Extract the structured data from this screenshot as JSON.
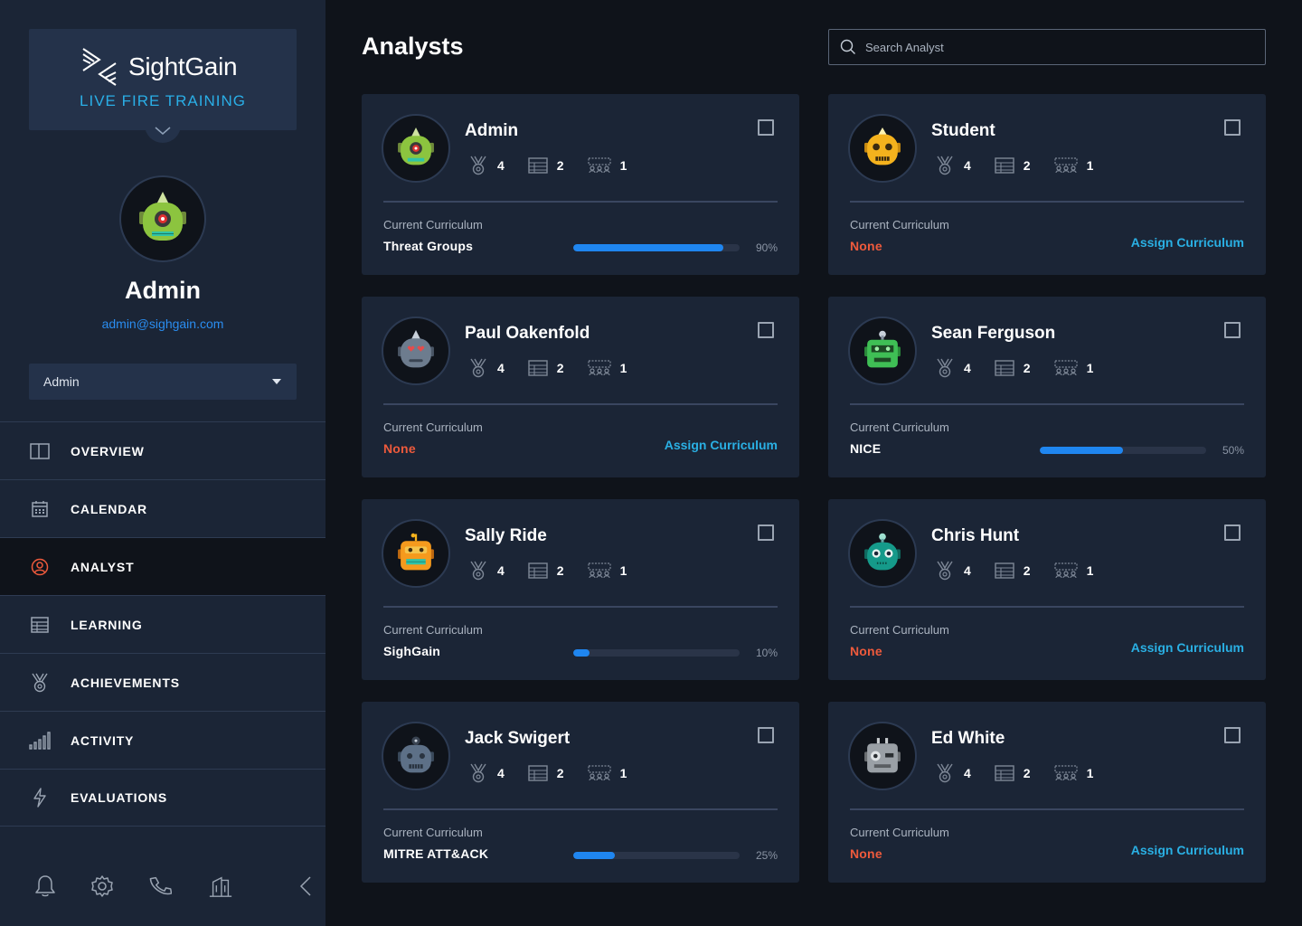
{
  "brand": {
    "name": "SightGain",
    "subtitle": "LIVE FIRE TRAINING"
  },
  "profile": {
    "name": "Admin",
    "email": "admin@sighgain.com",
    "role": "Admin"
  },
  "nav": [
    {
      "label": "OVERVIEW",
      "icon": "columns-icon"
    },
    {
      "label": "CALENDAR",
      "icon": "calendar-icon"
    },
    {
      "label": "ANALYST",
      "icon": "user-circle-icon",
      "active": true
    },
    {
      "label": "LEARNING",
      "icon": "table-icon"
    },
    {
      "label": "ACHIEVEMENTS",
      "icon": "medal-icon"
    },
    {
      "label": "ACTIVITY",
      "icon": "signal-bars-icon"
    },
    {
      "label": "EVALUATIONS",
      "icon": "lightning-icon"
    }
  ],
  "footer_icons": [
    "bell-icon",
    "gear-icon",
    "phone-icon",
    "building-icon",
    "collapse-chevron-icon"
  ],
  "page": {
    "title": "Analysts",
    "search_placeholder": "Search Analyst"
  },
  "labels": {
    "current_curriculum": "Current Curriculum",
    "assign": "Assign Curriculum"
  },
  "colors": {
    "accent_blue": "#1f86f0",
    "assign_cyan": "#2ab0e4",
    "none_red": "#ee5a3c",
    "sidebar": "#1b2536",
    "background": "#0f131a"
  },
  "analysts": [
    {
      "name": "Admin",
      "achievements": "4",
      "courses": "2",
      "teams": "1",
      "curriculum": "Threat Groups",
      "progress": 0.9,
      "progress_label": "90%",
      "avatar": "green-cyclops-robot"
    },
    {
      "name": "Student",
      "achievements": "4",
      "courses": "2",
      "teams": "1",
      "curriculum": "None",
      "progress": null,
      "progress_label": "",
      "avatar": "yellow-robot"
    },
    {
      "name": "Paul Oakenfold",
      "achievements": "4",
      "courses": "2",
      "teams": "1",
      "curriculum": "None",
      "progress": null,
      "progress_label": "",
      "avatar": "grey-heart-eyes-robot"
    },
    {
      "name": "Sean Ferguson",
      "achievements": "4",
      "courses": "2",
      "teams": "1",
      "curriculum": "NICE",
      "progress": 0.5,
      "progress_label": "50%",
      "avatar": "green-robot"
    },
    {
      "name": "Sally Ride",
      "achievements": "4",
      "courses": "2",
      "teams": "1",
      "curriculum": "SighGain",
      "progress": 0.1,
      "progress_label": "10%",
      "avatar": "orange-robot"
    },
    {
      "name": "Chris Hunt",
      "achievements": "4",
      "courses": "2",
      "teams": "1",
      "curriculum": "None",
      "progress": null,
      "progress_label": "",
      "avatar": "teal-robot"
    },
    {
      "name": "Jack Swigert",
      "achievements": "4",
      "courses": "2",
      "teams": "1",
      "curriculum": "MITRE ATT&ACK",
      "progress": 0.25,
      "progress_label": "25%",
      "avatar": "slate-robot"
    },
    {
      "name": "Ed White",
      "achievements": "4",
      "courses": "2",
      "teams": "1",
      "curriculum": "None",
      "progress": null,
      "progress_label": "",
      "avatar": "grey-robot"
    }
  ]
}
